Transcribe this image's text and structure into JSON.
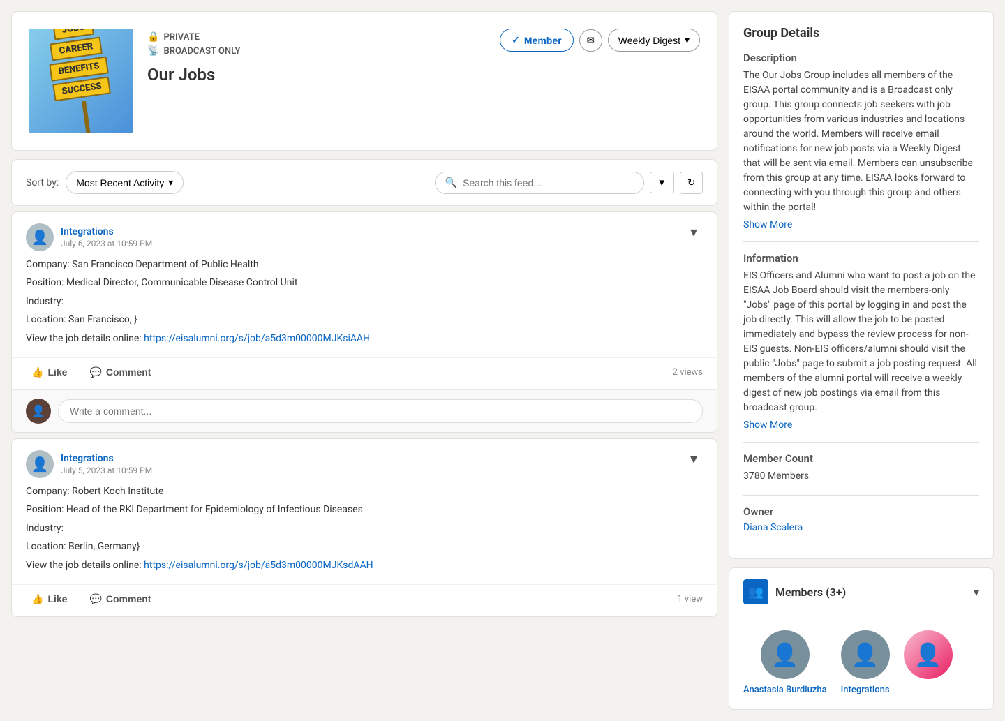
{
  "group": {
    "image_alt": "Jobs Career Benefits Success sign",
    "signs": [
      "JOBS",
      "CAREER",
      "BENEFITS",
      "SUCCESS"
    ],
    "privacy_label": "PRIVATE",
    "broadcast_label": "BROADCAST ONLY",
    "name": "Our Jobs",
    "member_button": "Member",
    "digest_label": "Weekly Digest"
  },
  "feed": {
    "sort_label": "Sort by:",
    "sort_value": "Most Recent Activity",
    "search_placeholder": "Search this feed...",
    "filter_icon": "▼",
    "refresh_icon": "↻"
  },
  "posts": [
    {
      "id": "post-1",
      "author": "Integrations",
      "date": "July 6, 2023 at 10:59 PM",
      "company": "Company: San Francisco Department of Public Health",
      "position": "Position: Medical Director, Communicable Disease Control Unit",
      "industry": "Industry:",
      "location": "Location: San Francisco, }",
      "link_label": "View the job details online:",
      "link_url": "https://eisalumni.org/s/job/a5d3m00000MJKsiAAH",
      "like_label": "Like",
      "comment_label": "Comment",
      "views": "2 views",
      "comment_placeholder": "Write a comment..."
    },
    {
      "id": "post-2",
      "author": "Integrations",
      "date": "July 5, 2023 at 10:59 PM",
      "company": "Company: Robert Koch Institute",
      "position": "Position: Head of the RKI Department for Epidemiology of Infectious Diseases",
      "industry": "Industry:",
      "location": "Location: Berlin, Germany}",
      "link_label": "View the job details online:",
      "link_url": "https://eisalumni.org/s/job/a5d3m00000MJKsdAAH",
      "like_label": "Like",
      "comment_label": "Comment",
      "views": "1 view"
    }
  ],
  "group_details": {
    "title": "Group Details",
    "description_title": "Description",
    "description_text": "The Our Jobs Group includes all members of the EISAA portal community and is a Broadcast only group. This group connects job seekers with job opportunities from various industries and locations around the world. Members will receive email notifications for new job posts via a Weekly Digest that will be sent via email. Members can unsubscribe from this group at any time. EISAA looks forward to connecting with you through this group and others within the portal!",
    "show_more_1": "Show More",
    "information_title": "Information",
    "information_text": "EIS Officers and Alumni who want to post a job on the EISAA Job Board should visit the members-only \"Jobs\" page of this portal by logging in and post the job directly. This will allow the job to be posted immediately and bypass the review process for non-EIS guests. Non-EIS officers/alumni should visit the public \"Jobs\" page to submit a job posting request. All members of the alumni portal will receive a weekly digest of new job postings via email from this broadcast group.",
    "show_more_2": "Show More",
    "member_count_title": "Member Count",
    "member_count": "3780 Members",
    "owner_title": "Owner",
    "owner_name": "Diana Scalera"
  },
  "members": {
    "title": "Members (3+)",
    "list": [
      {
        "name": "Anastasia Burdiuzha",
        "avatar_color": "#78909c"
      },
      {
        "name": "Integrations",
        "avatar_color": "#607d8b"
      },
      {
        "name": "",
        "avatar_color": "gradient-pink"
      }
    ]
  }
}
